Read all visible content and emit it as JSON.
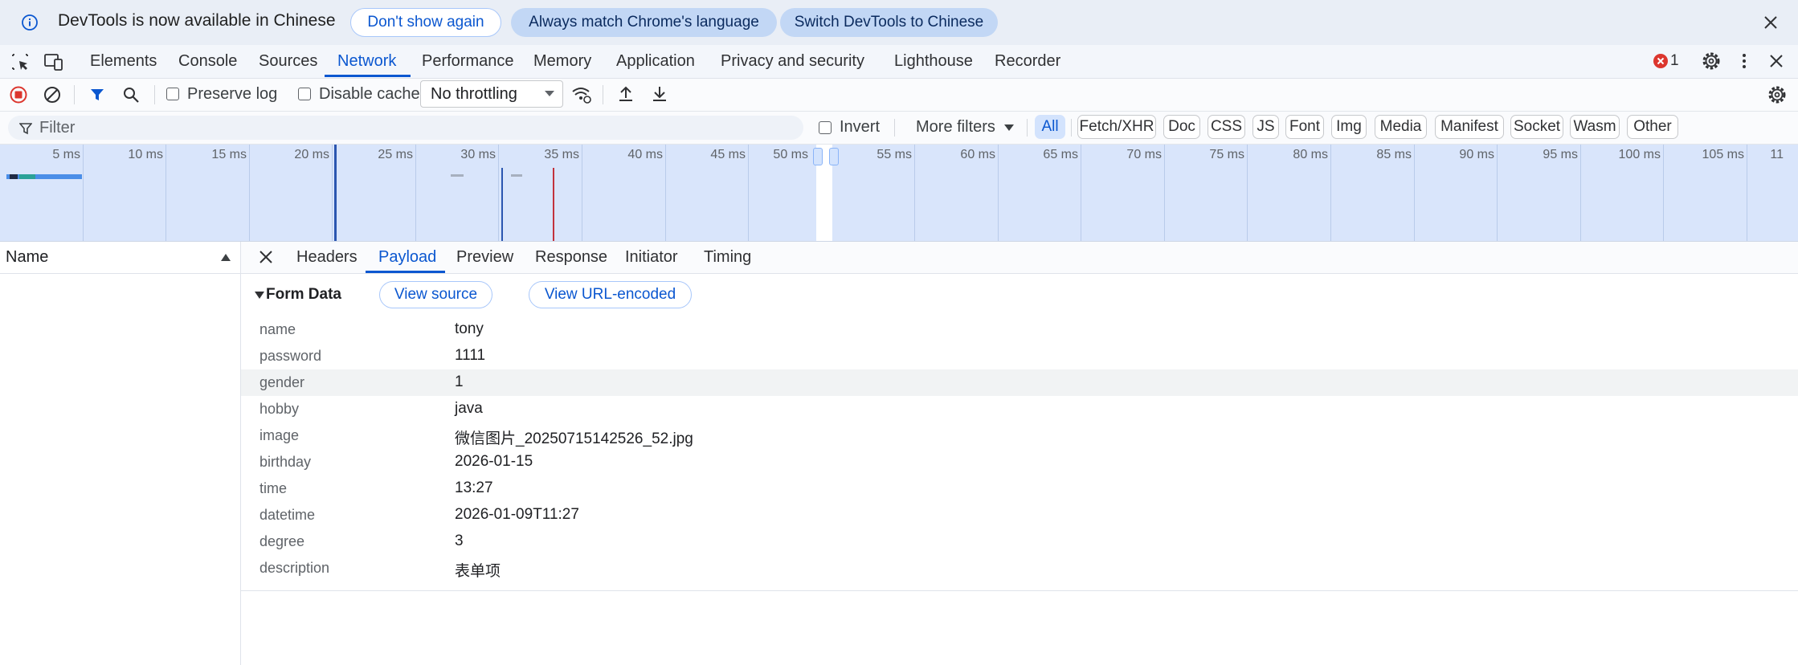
{
  "infobar": {
    "message": "DevTools is now available in Chinese",
    "dont_show": "Don't show again",
    "always_match": "Always match Chrome's language",
    "switch": "Switch DevTools to Chinese"
  },
  "tabs": [
    "Elements",
    "Console",
    "Sources",
    "Network",
    "Performance",
    "Memory",
    "Application",
    "Privacy and security",
    "Lighthouse",
    "Recorder"
  ],
  "error_count": "1",
  "toolbar": {
    "preserve_log": "Preserve log",
    "disable_cache": "Disable cache",
    "throttling": "No throttling"
  },
  "filterbar": {
    "placeholder": "Filter",
    "invert": "Invert",
    "more_filters": "More filters",
    "types": [
      "All",
      "Fetch/XHR",
      "Doc",
      "CSS",
      "JS",
      "Font",
      "Img",
      "Media",
      "Manifest",
      "Socket",
      "Wasm",
      "Other"
    ]
  },
  "overview": {
    "ticks": [
      "5 ms",
      "10 ms",
      "15 ms",
      "20 ms",
      "25 ms",
      "30 ms",
      "35 ms",
      "40 ms",
      "45 ms",
      "50 ms",
      "55 ms",
      "60 ms",
      "65 ms",
      "70 ms",
      "75 ms",
      "80 ms",
      "85 ms",
      "90 ms",
      "95 ms",
      "100 ms",
      "105 ms",
      "11"
    ]
  },
  "requests": {
    "name_header": "Name"
  },
  "detail": {
    "tabs": [
      "Headers",
      "Payload",
      "Preview",
      "Response",
      "Initiator",
      "Timing"
    ],
    "section_title": "Form Data",
    "view_source": "View source",
    "view_url_encoded": "View URL-encoded",
    "form_data": [
      {
        "key": "name",
        "value": "tony"
      },
      {
        "key": "password",
        "value": "1111"
      },
      {
        "key": "gender",
        "value": "1"
      },
      {
        "key": "hobby",
        "value": "java"
      },
      {
        "key": "image",
        "value": "微信图片_20250715142526_52.jpg"
      },
      {
        "key": "birthday",
        "value": "2026-01-15"
      },
      {
        "key": "time",
        "value": "13:27"
      },
      {
        "key": "datetime",
        "value": "2026-01-09T11:27"
      },
      {
        "key": "degree",
        "value": "3"
      },
      {
        "key": "description",
        "value": "表单项"
      }
    ]
  },
  "colors": {
    "accent": "#0b57d0",
    "error": "#dc362e",
    "record": "#dc362e"
  }
}
